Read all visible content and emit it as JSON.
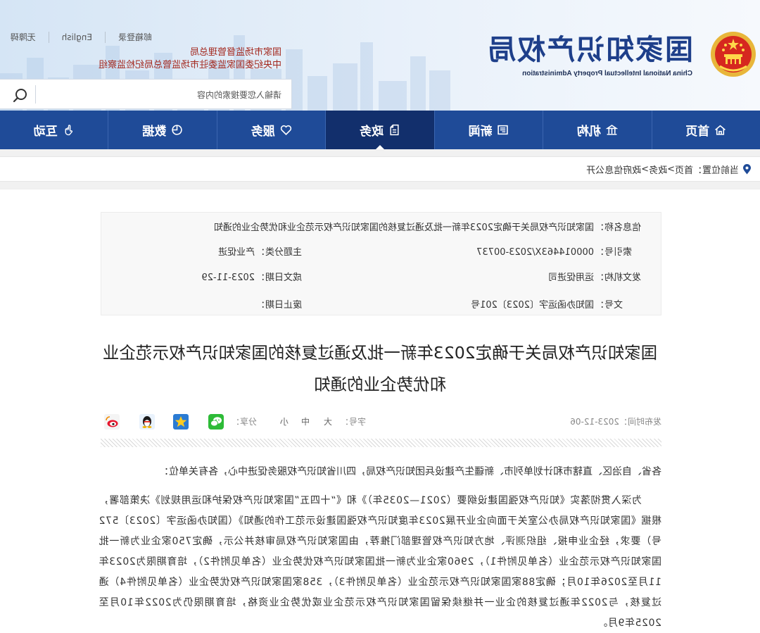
{
  "header": {
    "emblem_icon": "national-emblem-icon",
    "site_title": "国家知识产权局",
    "site_subtitle": "China National Intellectual Property Administration",
    "top_links": {
      "mail": "邮箱登录",
      "english": "English",
      "accessibility": "无障碍"
    },
    "affiliates": [
      "国家市场监督管理总局",
      "中央纪委国家监委驻市场监管总局纪检监察组"
    ],
    "search": {
      "placeholder": "请输入您要搜索的内容",
      "icon": "search-icon"
    }
  },
  "nav": {
    "active": "政务",
    "items": [
      {
        "label": "首页",
        "icon": "home-icon"
      },
      {
        "label": "机构",
        "icon": "building-icon"
      },
      {
        "label": "新闻",
        "icon": "news-icon"
      },
      {
        "label": "政务",
        "icon": "document-icon"
      },
      {
        "label": "服务",
        "icon": "heart-icon"
      },
      {
        "label": "数据",
        "icon": "pie-chart-icon"
      },
      {
        "label": "互动",
        "icon": "hand-icon"
      }
    ]
  },
  "breadcrumb": {
    "icon": "location-pin-icon",
    "prefix": "当前位置：",
    "separator": ">",
    "items": [
      "首页",
      "政务",
      "政府信息公开"
    ]
  },
  "info": {
    "name": {
      "label": "信息名称：",
      "value": "国家知识产权局关于确定2023年新一批及通过复核的国家知识产权示范企业和优势企业的通知"
    },
    "index_no": {
      "label": "索引号：",
      "value": "000014463X/2023-00737"
    },
    "topic": {
      "label": "主题分类：",
      "value": "产业促进"
    },
    "issuer": {
      "label": "发文机构：",
      "value": "运用促进司"
    },
    "date_written": {
      "label": "成文日期：",
      "value": "2023-11-29"
    },
    "doc_no": {
      "label": "文号：",
      "value": "国知办函运字〔2023〕201号"
    },
    "expiry": {
      "label": "废止日期：",
      "value": ""
    }
  },
  "article": {
    "title": "国家知识产权局关于确定2023年新一批及通过复核的国家知识产权示范企业和优势企业的通知",
    "published": {
      "label": "发布时间：",
      "value": "2023-12-06"
    },
    "font_size": {
      "label": "字号：",
      "options": [
        "大",
        "中",
        "小"
      ]
    },
    "share": {
      "label": "分享：",
      "icons": [
        "wechat-icon",
        "qzone-icon",
        "qq-icon",
        "weibo-icon"
      ]
    },
    "greeting": "各省、自治区、直辖市和计划单列市、新疆生产建设兵团知识产权局，四川省知识产权服务促进中心，各有关单位：",
    "body": "为深入贯彻落实《知识产权强国建设纲要（2021—2035年）》和《“十四五”国家知识产权保护和运用规划》决策部署，根据《国家知识产权局办公室关于面向企业开展2023年度知识产权强国建设示范工作的通知》（国知办函运字〔2023〕572号）要求，经企业申报、组织测评、地方知识产权管理部门推荐，由国家知识产权局审核并公示，确定750家企业为新一批国家知识产权示范企业（名单见附件1），2960家企业为新一批国家知识产权优势企业（名单见附件2），培育期限为2023年11月至2026年10月；确定88家国家知识产权示范企业（名单见附件3），358家国家知识产权优势企业（名单见附件4）通过复核，与2022年通过复核的企业一并继续保留国家知识产权示范企业或优势企业资格，培育期限仍为2022年10月至2025年9月。"
  },
  "colors": {
    "nav_background": "#1f4b98",
    "nav_active": "#122f6c",
    "site_title": "#1e3f8a",
    "affiliate_text": "#a3281e"
  }
}
